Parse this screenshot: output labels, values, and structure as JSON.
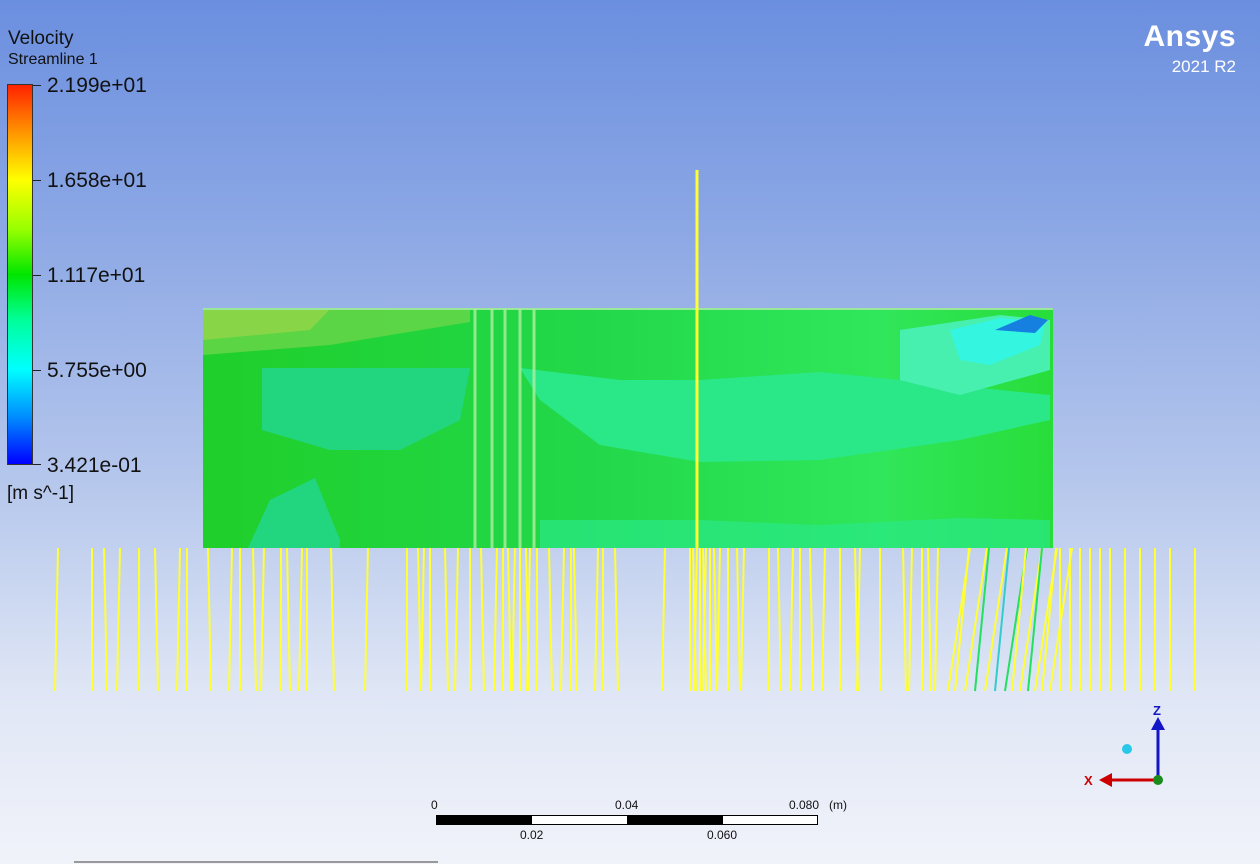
{
  "app": {
    "brand": "Ansys",
    "version": "2021 R2"
  },
  "legend": {
    "title": "Velocity",
    "subtitle": "Streamline 1",
    "values": [
      "2.199e+01",
      "1.658e+01",
      "1.117e+01",
      "5.755e+00",
      "3.421e-01"
    ],
    "unit": "[m s^-1]"
  },
  "scale_bar": {
    "top_labels": [
      "0",
      "0.04",
      "0.080"
    ],
    "bottom_labels": [
      "0.02",
      "0.060"
    ],
    "unit": "(m)"
  },
  "axes": {
    "z": "Z",
    "x": "X"
  },
  "colors": {
    "streamline": "#ffff33",
    "domain": "#22dd22",
    "axis_z": "#1515c8",
    "axis_x": "#cc0000"
  }
}
